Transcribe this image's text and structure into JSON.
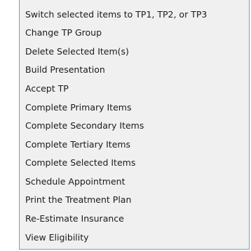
{
  "context_menu": {
    "items": [
      {
        "label": "Switch selected items to TP1, TP2, or TP3"
      },
      {
        "label": "Change TP Group"
      },
      {
        "label": "Delete Selected Item(s)"
      },
      {
        "label": "Build Presentation"
      },
      {
        "label": "Accept TP"
      },
      {
        "label": "Complete Primary Items"
      },
      {
        "label": "Complete Secondary Items"
      },
      {
        "label": "Complete Tertiary Items"
      },
      {
        "label": "Complete Selected Items"
      },
      {
        "label": "Schedule Appointment"
      },
      {
        "label": "Print the Treatment Plan"
      },
      {
        "label": "Re-Estimate Insurance"
      },
      {
        "label": "View Eligibility"
      }
    ]
  }
}
